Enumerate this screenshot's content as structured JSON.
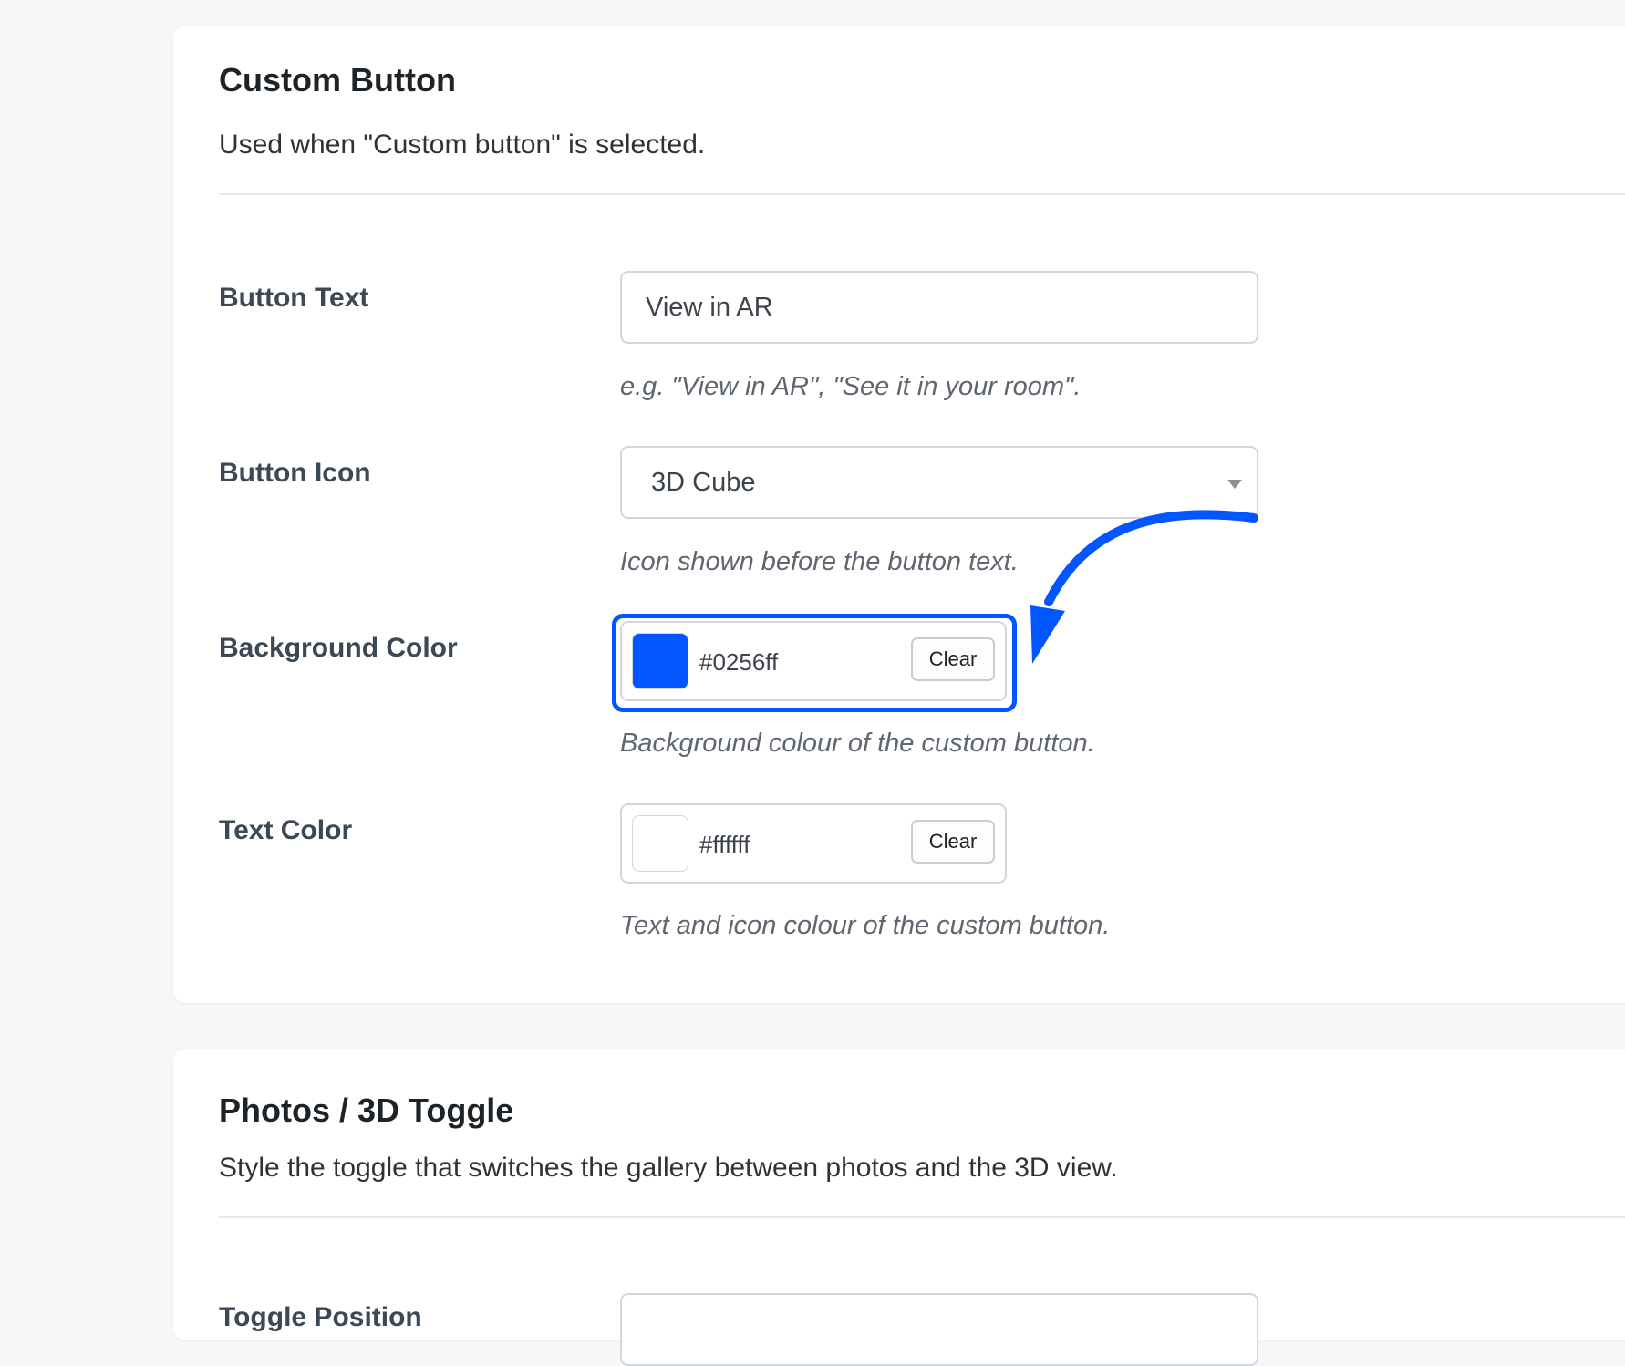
{
  "custom_button": {
    "title": "Custom Button",
    "description": "Used when \"Custom button\" is selected.",
    "fields": {
      "button_text": {
        "label": "Button Text",
        "value": "View in AR",
        "help": "e.g. \"View in AR\", \"See it in your room\"."
      },
      "button_icon": {
        "label": "Button Icon",
        "selected": "3D Cube",
        "help": "Icon shown before the button text."
      },
      "background_color": {
        "label": "Background Color",
        "value": "#0256ff",
        "swatch": "#0256ff",
        "clear_label": "Clear",
        "help": "Background colour of the custom button."
      },
      "text_color": {
        "label": "Text Color",
        "value": "#ffffff",
        "swatch": "#ffffff",
        "clear_label": "Clear",
        "help": "Text and icon colour of the custom button."
      }
    }
  },
  "photos_toggle": {
    "title": "Photos / 3D Toggle",
    "description": "Style the toggle that switches the gallery between photos and the 3D view.",
    "fields": {
      "toggle_position": {
        "label": "Toggle Position"
      }
    }
  },
  "annotation": {
    "accent_color": "#0256ff",
    "icon": "curved-arrow-icon"
  }
}
